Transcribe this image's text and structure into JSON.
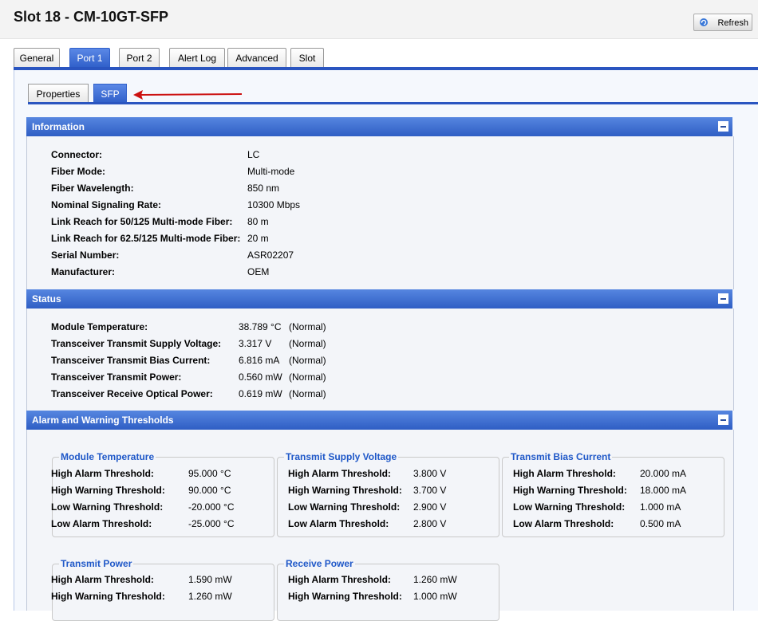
{
  "header": {
    "title": "Slot 18 - CM-10GT-SFP",
    "refresh_label": "Refresh"
  },
  "tabs": [
    {
      "label": "General"
    },
    {
      "label": "Port 1"
    },
    {
      "label": "Port 2"
    },
    {
      "label": "Alert Log"
    },
    {
      "label": "Advanced"
    },
    {
      "label": "Slot"
    }
  ],
  "subtabs": [
    {
      "label": "Properties"
    },
    {
      "label": "SFP"
    }
  ],
  "information": {
    "title": "Information",
    "rows": [
      {
        "label": "Connector:",
        "value": "LC"
      },
      {
        "label": "Fiber Mode:",
        "value": "Multi-mode"
      },
      {
        "label": "Fiber Wavelength:",
        "value": "850 nm"
      },
      {
        "label": "Nominal Signaling Rate:",
        "value": "10300 Mbps"
      },
      {
        "label": "Link Reach for 50/125 Multi-mode Fiber:",
        "value": "80 m"
      },
      {
        "label": "Link Reach for 62.5/125 Multi-mode Fiber:",
        "value": "20 m"
      },
      {
        "label": "Serial Number:",
        "value": "ASR02207"
      },
      {
        "label": "Manufacturer:",
        "value": "OEM"
      }
    ]
  },
  "status": {
    "title": "Status",
    "rows": [
      {
        "label": "Module Temperature:",
        "value": "38.789 °C",
        "state": "(Normal)"
      },
      {
        "label": "Transceiver Transmit Supply Voltage:",
        "value": "3.317 V",
        "state": "(Normal)"
      },
      {
        "label": "Transceiver Transmit Bias Current:",
        "value": "6.816 mA",
        "state": "(Normal)"
      },
      {
        "label": "Transceiver Transmit Power:",
        "value": "0.560 mW",
        "state": "(Normal)"
      },
      {
        "label": "Transceiver Receive Optical Power:",
        "value": "0.619 mW",
        "state": "(Normal)"
      }
    ]
  },
  "thresholds": {
    "title": "Alarm and Warning Thresholds",
    "groups": [
      {
        "title": "Module Temperature",
        "rows": [
          {
            "label": "High Alarm Threshold:",
            "value": "95.000 °C"
          },
          {
            "label": "High Warning Threshold:",
            "value": "90.000 °C"
          },
          {
            "label": "Low Warning Threshold:",
            "value": "-20.000 °C"
          },
          {
            "label": "Low Alarm Threshold:",
            "value": "-25.000 °C"
          }
        ]
      },
      {
        "title": "Transmit Supply Voltage",
        "rows": [
          {
            "label": "High Alarm Threshold:",
            "value": "3.800 V"
          },
          {
            "label": "High Warning Threshold:",
            "value": "3.700 V"
          },
          {
            "label": "Low Warning Threshold:",
            "value": "2.900 V"
          },
          {
            "label": "Low Alarm Threshold:",
            "value": "2.800 V"
          }
        ]
      },
      {
        "title": "Transmit Bias Current",
        "rows": [
          {
            "label": "High Alarm Threshold:",
            "value": "20.000 mA"
          },
          {
            "label": "High Warning Threshold:",
            "value": "18.000 mA"
          },
          {
            "label": "Low Warning Threshold:",
            "value": "1.000 mA"
          },
          {
            "label": "Low Alarm Threshold:",
            "value": "0.500 mA"
          }
        ]
      },
      {
        "title": "Transmit Power",
        "rows": [
          {
            "label": "High Alarm Threshold:",
            "value": "1.590 mW"
          },
          {
            "label": "High Warning Threshold:",
            "value": "1.260 mW"
          }
        ]
      },
      {
        "title": "Receive Power",
        "rows": [
          {
            "label": "High Alarm Threshold:",
            "value": "1.260 mW"
          },
          {
            "label": "High Warning Threshold:",
            "value": "1.000 mW"
          }
        ]
      }
    ]
  },
  "colors": {
    "accent": "#2a55c0",
    "legend": "#1f58c8",
    "arrow": "#cc1111"
  }
}
